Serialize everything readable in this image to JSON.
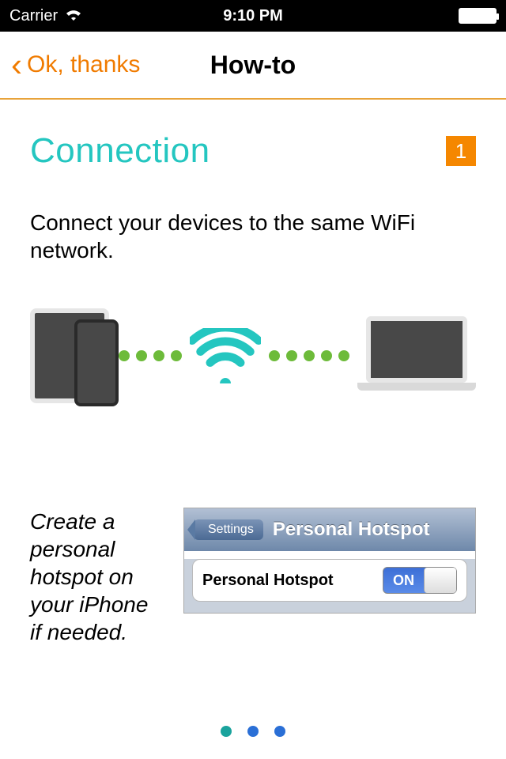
{
  "status": {
    "carrier": "Carrier",
    "time": "9:10 PM"
  },
  "nav": {
    "back_label": "Ok, thanks",
    "title": "How-to"
  },
  "section": {
    "title": "Connection",
    "step": "1"
  },
  "body": "Connect your devices to the same WiFi network.",
  "hotspot": {
    "hint": "Create a personal hotspot on your iPhone if needed.",
    "panel": {
      "back": "Settings",
      "title": "Personal Hotspot",
      "cell_label": "Personal Hotspot",
      "switch": "ON"
    }
  },
  "colors": {
    "accent_teal": "#24c6c0",
    "accent_blue": "#2a6fd6",
    "orange": "#f58700"
  },
  "pager": {
    "count": 3,
    "current": 0
  }
}
